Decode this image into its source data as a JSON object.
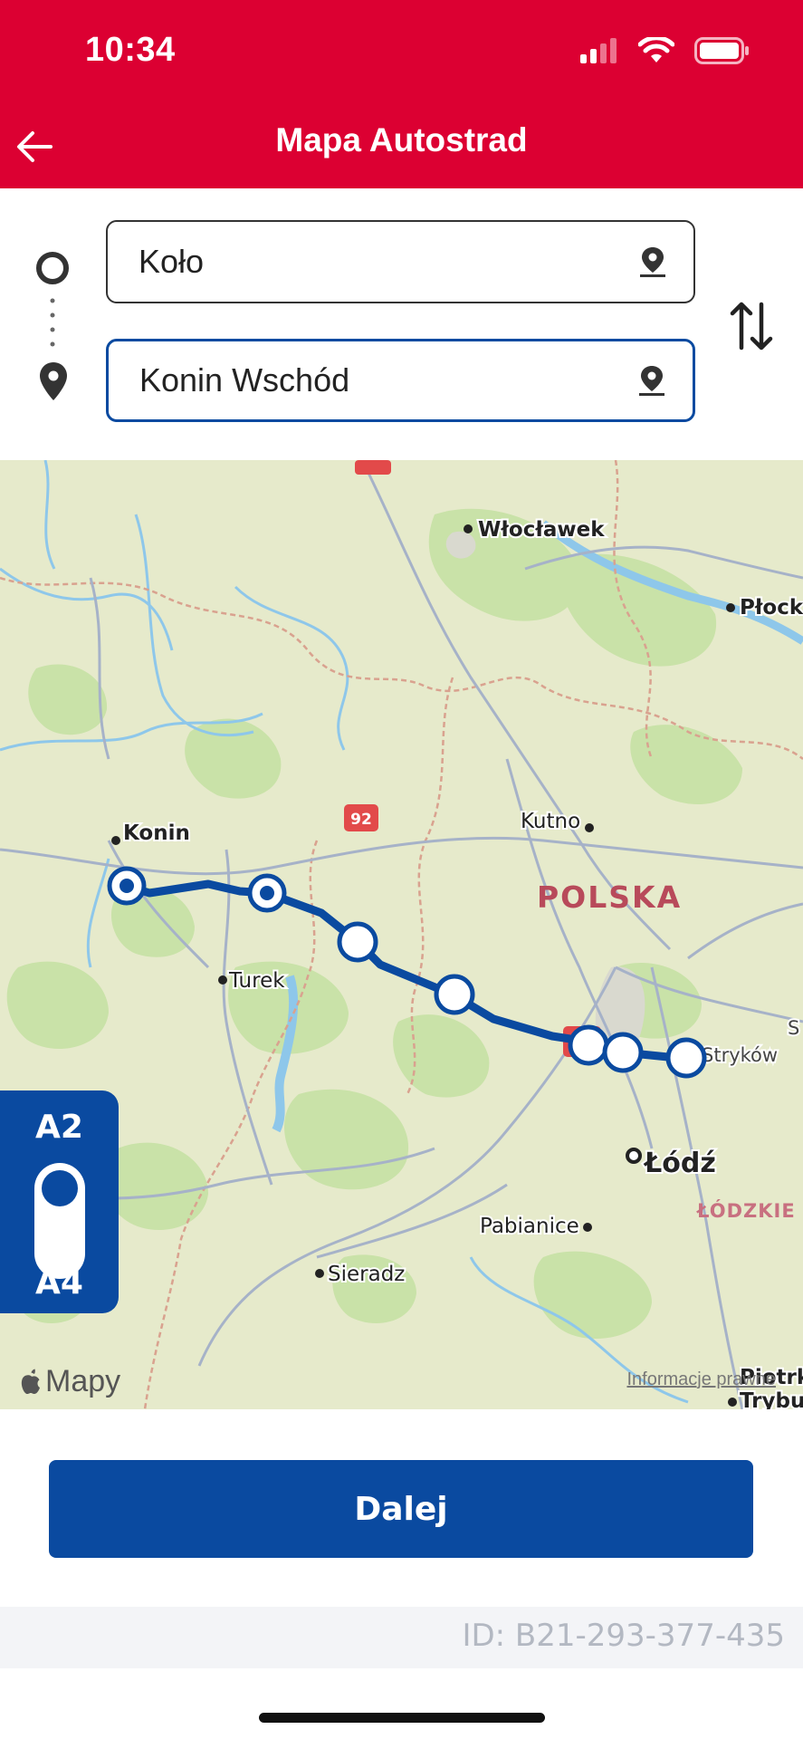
{
  "theme": {
    "header_color": "#dc0032",
    "primary_blue": "#0a4aa0"
  },
  "status_bar": {
    "time": "10:34",
    "icons": [
      "signal-icon",
      "wifi-icon",
      "battery-icon"
    ]
  },
  "header": {
    "title": "Mapa Autostrad",
    "back_icon": "arrow-left-icon"
  },
  "route": {
    "origin": {
      "value": "Koło",
      "icon": "location-pin-icon"
    },
    "destination": {
      "value": "Konin Wschód",
      "icon": "location-pin-icon"
    },
    "swap_icon": "swap-vertical-icon"
  },
  "map": {
    "places": {
      "wloclawek": "Włocławek",
      "plock": "Płock",
      "konin": "Konin",
      "kutno": "Kutno",
      "polska": "POLSKA",
      "turek": "Turek",
      "strykow": "Stryków",
      "lodz": "Łódź",
      "lodzkie": "ŁÓDZKIE",
      "pabianice": "Pabianice",
      "sieradz": "Sieradz",
      "piotrkow": "Piotrk",
      "trybunalski": "Trybu",
      "edge_s": "S"
    },
    "road_badge": "92",
    "motorway_toggle": {
      "top": "A2",
      "bottom": "A4",
      "selected": "A2"
    },
    "attribution": "Mapy",
    "legal": "Informacje prawne"
  },
  "actions": {
    "next": "Dalej"
  },
  "footer": {
    "id_text": "ID: B21-293-377-435"
  }
}
